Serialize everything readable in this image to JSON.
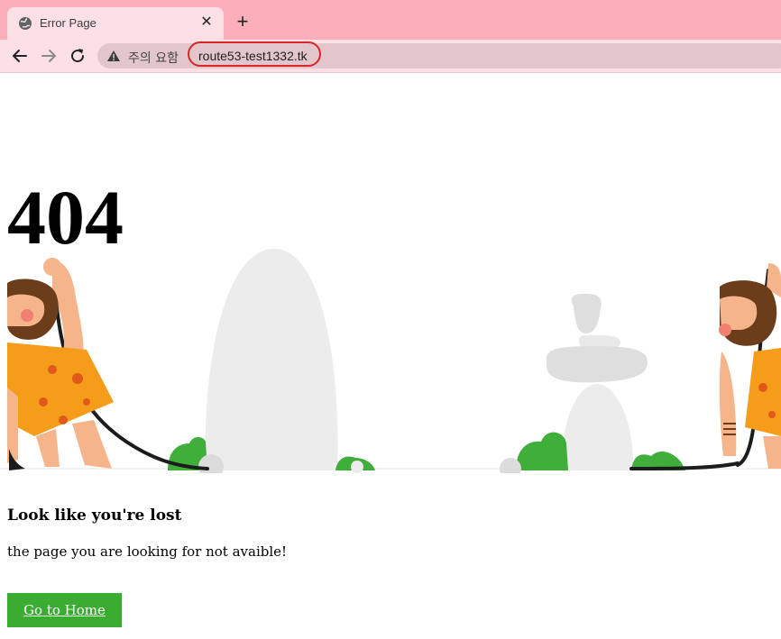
{
  "browser": {
    "tab": {
      "title": "Error Page",
      "close_glyph": "✕"
    },
    "new_tab_glyph": "+",
    "omnibox": {
      "security_text": "주의 요함",
      "url": "route53-test1332.tk"
    },
    "icons": [
      "globe-icon",
      "close-icon",
      "plus-icon",
      "arrow-left-icon",
      "arrow-right-icon",
      "reload-icon",
      "warning-icon"
    ]
  },
  "page": {
    "code": "404",
    "heading": "Look like you're lost",
    "message": "the page you are looking for not avaible!",
    "home_button_label": "Go to Home",
    "colors": {
      "button": "#39ac31",
      "grass": "#3fae3a",
      "rock": "#ececec",
      "skin": "#f5b48a",
      "hair": "#6b3d1b",
      "tunic": "#f59c1a"
    }
  }
}
